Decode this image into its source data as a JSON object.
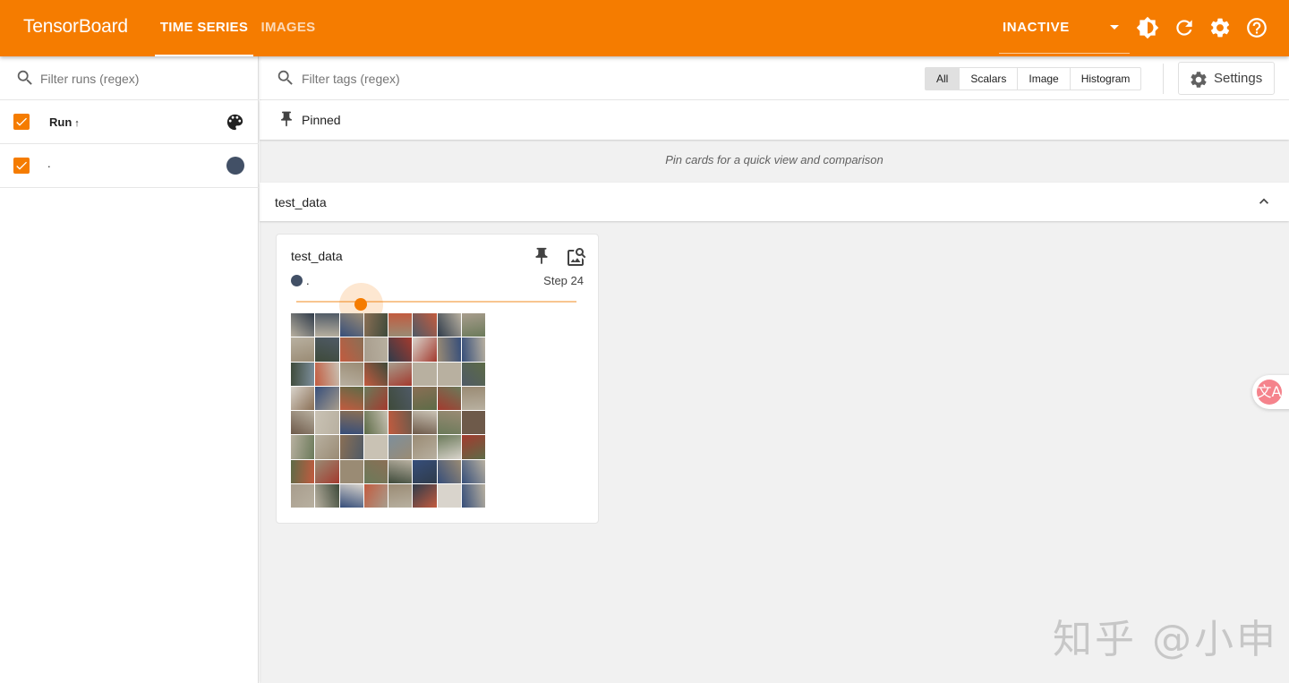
{
  "app": {
    "brand": "TensorBoard",
    "tabs": [
      {
        "label": "TIME SERIES",
        "active": true
      },
      {
        "label": "IMAGES",
        "active": false
      }
    ],
    "plugin_selector": "INACTIVE",
    "icons": [
      "dark-mode-icon",
      "refresh-icon",
      "settings-icon",
      "help-icon"
    ],
    "accent_color": "#f57c00"
  },
  "sidebar": {
    "filter_placeholder": "Filter runs (regex)",
    "header_label": "Run",
    "sort_indicator": "↑",
    "runs": [
      {
        "name": ".",
        "checked": true,
        "color": "#425066"
      }
    ]
  },
  "toolbar": {
    "filter_placeholder": "Filter tags (regex)",
    "types": [
      "All",
      "Scalars",
      "Image",
      "Histogram"
    ],
    "active_type": "All",
    "settings_label": "Settings"
  },
  "pinned": {
    "label": "Pinned",
    "empty_message": "Pin cards for a quick view and comparison"
  },
  "group": {
    "name": "test_data",
    "expanded": true
  },
  "card": {
    "title": "test_data",
    "run_name": ".",
    "step_label": "Step 24",
    "slider_fraction": 0.23
  },
  "widget": {
    "badge_glyph": "文A",
    "watermark": "知乎 @小申"
  }
}
